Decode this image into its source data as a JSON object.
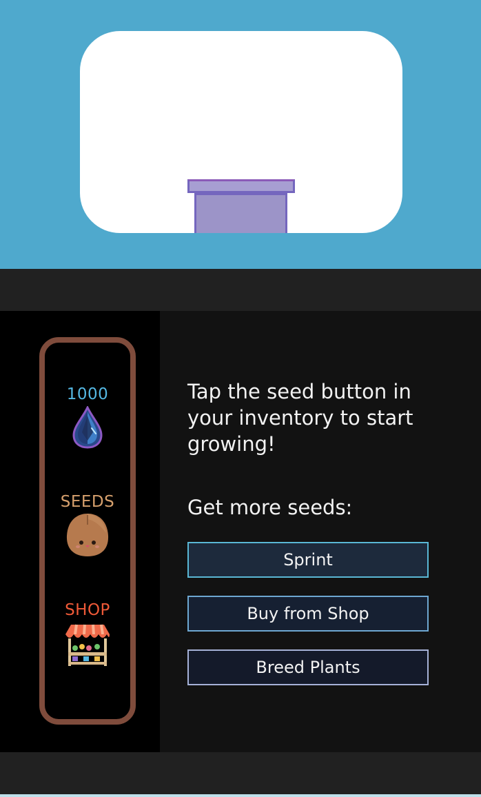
{
  "inventory": {
    "water": {
      "count": "1000",
      "icon": "water-drop-icon"
    },
    "seeds": {
      "label": "SEEDS",
      "icon": "seed-icon"
    },
    "shop": {
      "label": "SHOP",
      "icon": "market-stall-icon"
    }
  },
  "panel": {
    "message": "Tap the seed button in your inventory to start growing!",
    "subheading": "Get more seeds:",
    "buttons": {
      "sprint": "Sprint",
      "buy": "Buy from Shop",
      "breed": "Breed Plants"
    }
  },
  "colors": {
    "sky": "#4fa9cd",
    "frame": "#7f4c3c",
    "water_text": "#55b8e3",
    "seeds_text": "#d6a06d",
    "shop_text": "#ef5a38"
  }
}
